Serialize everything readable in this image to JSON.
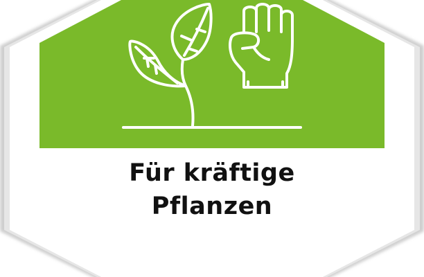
{
  "badge": {
    "caption_line1": "Für kräftige",
    "caption_line2": "Pflanzen",
    "icons": [
      "leaf-sprout-icon",
      "raised-fist-icon"
    ],
    "colors": {
      "accent_green": "#7aba2a",
      "badge_white": "#ffffff",
      "text": "#111111",
      "border_shadow": "#c9c9c9"
    }
  }
}
